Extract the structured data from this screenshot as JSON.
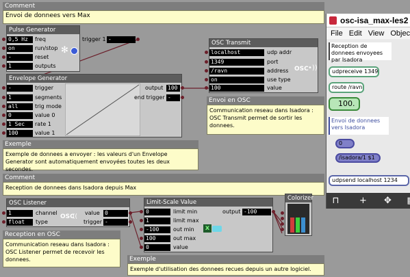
{
  "comments": {
    "top": {
      "head": "Comment",
      "body": "Envoi de donnees vers Max"
    },
    "envoi_osc": {
      "head": "Envoi en OSC",
      "body": "Communication reseau dans Isadora : OSC Transmit permet de sortir les donnees."
    },
    "exemple1": {
      "head": "Exemple",
      "body": "Exemple de donnees a envoyer : les valeurs d'un Envelope Generator sont automatiquement envoyées toutes les deux secondes."
    },
    "reception": {
      "head": "Comment",
      "body": "Reception de donnees dans Isadora depuis Max"
    },
    "reception_osc": {
      "head": "Reception en OSC",
      "body": "Communication reseau dans Isadora : OSC Listener permet de recevoir les donnees."
    },
    "exemple2": {
      "head": "Exemple",
      "body": "Exemple d'utilisation des donnees recues depuis un autre logiciel."
    }
  },
  "pulse": {
    "title": "Pulse Generator",
    "freq": "0,5 Hz",
    "freq_lbl": "freq",
    "runstop": "on",
    "runstop_lbl": "run/stop",
    "reset": "-",
    "reset_lbl": "reset",
    "outputs": "1",
    "outputs_lbl": "outputs",
    "trigger_lbl": "trigger 1",
    "trigger_val": "-"
  },
  "envelope": {
    "title": "Envelope Generator",
    "trigger": "-",
    "trigger_lbl": "trigger",
    "segments": "1",
    "segments_lbl": "segments",
    "trigmode": "all",
    "trigmode_lbl": "trig mode",
    "value0": "0",
    "value0_lbl": "value 0",
    "rate1": "1 Sec",
    "rate1_lbl": "rate 1",
    "value1": "100",
    "value1_lbl": "value 1",
    "output_lbl": "output",
    "output_val": "100",
    "endtrigger_lbl": "end trigger",
    "endtrigger_val": "-"
  },
  "osc_transmit": {
    "title": "OSC Transmit",
    "udpaddr": "localhost",
    "udpaddr_lbl": "udp addr",
    "port": "1349",
    "port_lbl": "port",
    "address": "/ravn",
    "address_lbl": "address",
    "usetype": "on",
    "usetype_lbl": "use type",
    "value": "100",
    "value_lbl": "value",
    "logo": "OSC"
  },
  "osc_listener": {
    "title": "OSC Listener",
    "channel": "1",
    "channel_lbl": "channel",
    "type": "float",
    "type_lbl": "type",
    "value_lbl": "value",
    "value_val": "0",
    "trigger_lbl": "trigger",
    "trigger_val": "-",
    "logo": "OSC"
  },
  "limit_scale": {
    "title": "Limit-Scale Value",
    "limitmin": "0",
    "limitmin_lbl": "limit min",
    "limitmax": "1",
    "limitmax_lbl": "limit max",
    "outmin": "-100",
    "outmin_lbl": "out min",
    "outmax": "100",
    "outmax_lbl": "out max",
    "value": "0",
    "value_lbl": "value",
    "output_lbl": "output",
    "output_val": "-100"
  },
  "colorizer": {
    "title": "Colorizer"
  },
  "max_window": {
    "title": "osc-isa_max-les2",
    "menu": [
      "File",
      "Edit",
      "View",
      "Objec"
    ],
    "comment1": "Reception de donnees envoyees par Isadora",
    "udpreceive": "udpreceive 1349",
    "route": "route /ravn",
    "number": "100.",
    "comment2": "Envoi de donnees vers Isadora",
    "int_val": "0",
    "msg": "/isadora/1 $1",
    "udpsend": "udpsend localhost 1234",
    "toolbar": [
      "lock-icon",
      "add-icon",
      "move-icon",
      "grid-icon"
    ]
  },
  "colors": {
    "port": "#6b1f2a",
    "comment_bg": "#fdfcc9",
    "title_bg": "#5c5c5c",
    "max_obj_border": "#5aa37a"
  }
}
